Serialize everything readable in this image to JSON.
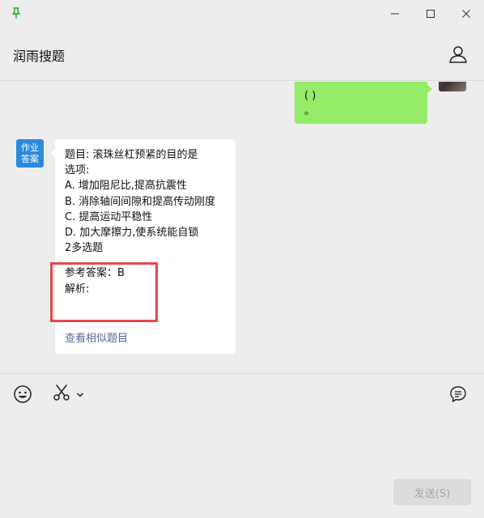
{
  "window": {
    "pin_icon": "pin-icon",
    "pin_color": "#1aad19"
  },
  "header": {
    "title": "润雨搜题",
    "profile_icon": "user-icon"
  },
  "chat": {
    "outgoing": {
      "lines": [
        "( )",
        "。"
      ]
    },
    "incoming": {
      "avatar_lines": [
        "作业",
        "答案"
      ],
      "question": "题目: 滚珠丝杠预紧的目的是",
      "options_label": "选项:",
      "options": [
        "A. 增加阻尼比,提高抗震性",
        "B. 消除轴间间隙和提高传动刚度",
        "C. 提高运动平稳性",
        "D. 加大摩擦力,使系统能自锁"
      ],
      "type_line": "2多选题",
      "answer_line": "参考答案：B",
      "analysis_line": "解析:",
      "similar_link": "查看相似题目"
    }
  },
  "toolbar": {
    "icons": [
      "emoji-icon",
      "scissors-icon",
      "chevron-down-icon",
      "chat-history-icon"
    ]
  },
  "input": {
    "send_label": "发送(S)"
  },
  "colors": {
    "bubble_out": "#95ec69",
    "bubble_in": "#ffffff",
    "avatar_bg": "#2b8ae0",
    "link": "#576b95",
    "highlight": "#e5484d"
  }
}
